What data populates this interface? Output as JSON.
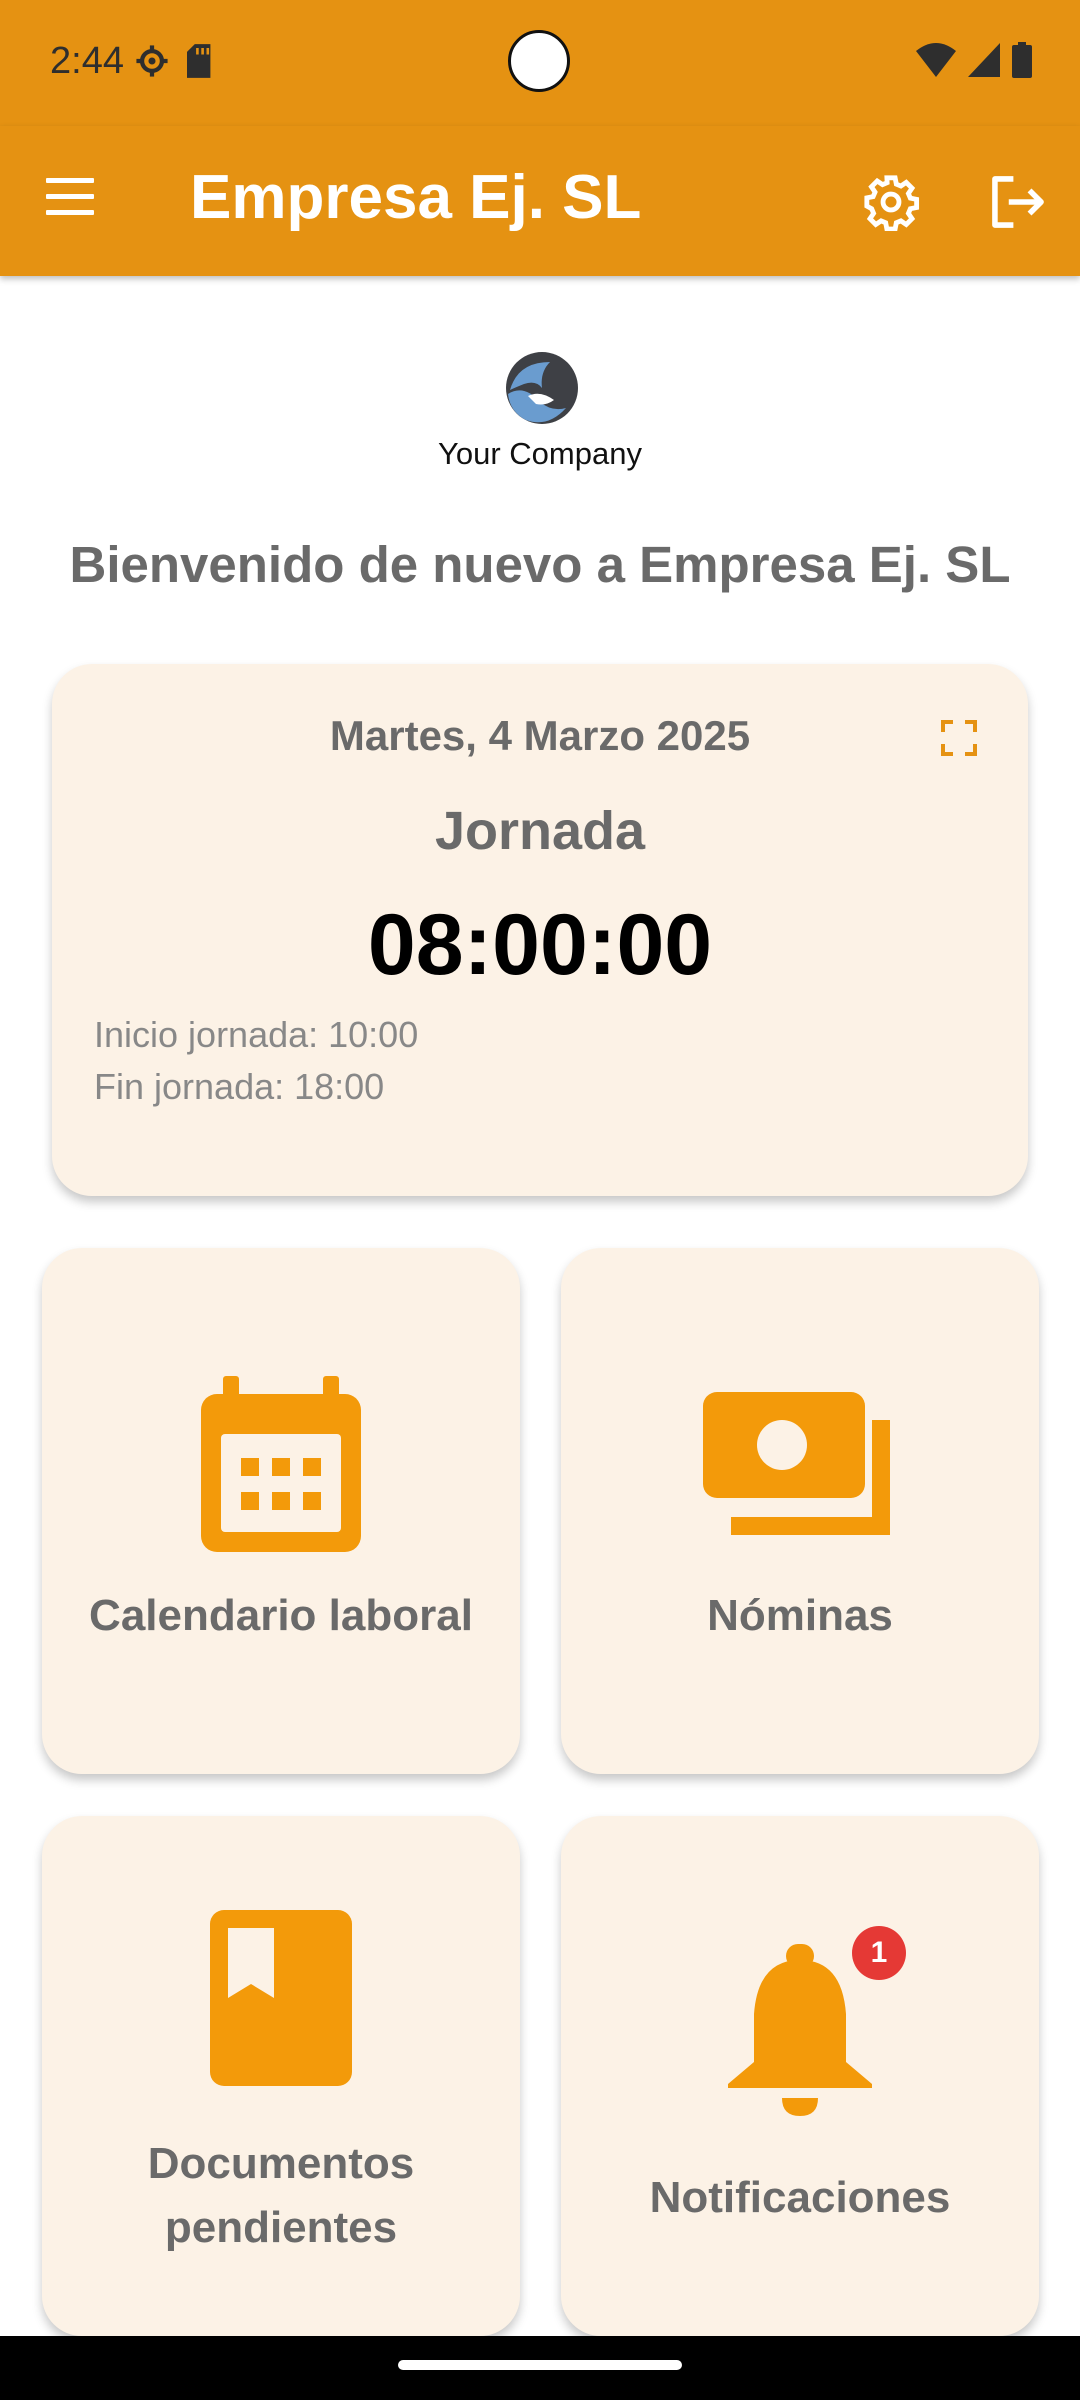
{
  "status_bar": {
    "time": "2:44",
    "icons": [
      "settings-status-icon",
      "sd-card-icon",
      "wifi-icon",
      "signal-icon",
      "battery-icon"
    ]
  },
  "app_bar": {
    "title": "Empresa Ej. SL",
    "icons": [
      "menu-icon",
      "gear-icon",
      "logout-icon"
    ]
  },
  "logo": {
    "text": "Your Company"
  },
  "welcome": "Bienvenido de nuevo a Empresa Ej. SL",
  "work_card": {
    "date": "Martes, 4 Marzo 2025",
    "label": "Jornada",
    "time": "08:00:00",
    "start": "Inicio jornada: 10:00",
    "end": "Fin jornada: 18:00",
    "icon": "expand-icon"
  },
  "tiles": [
    {
      "label": "Calendario laboral",
      "icon": "calendar-icon"
    },
    {
      "label": "Nóminas",
      "icon": "payments-icon"
    },
    {
      "label": "Documentos pendientes",
      "icon": "book-icon"
    },
    {
      "label": "Notificaciones",
      "icon": "bell-icon",
      "badge": "1"
    }
  ],
  "colors": {
    "primary": "#e59212",
    "icon_accent": "#f39a0a",
    "card_background": "#fcf2e6",
    "badge": "#e53935"
  }
}
